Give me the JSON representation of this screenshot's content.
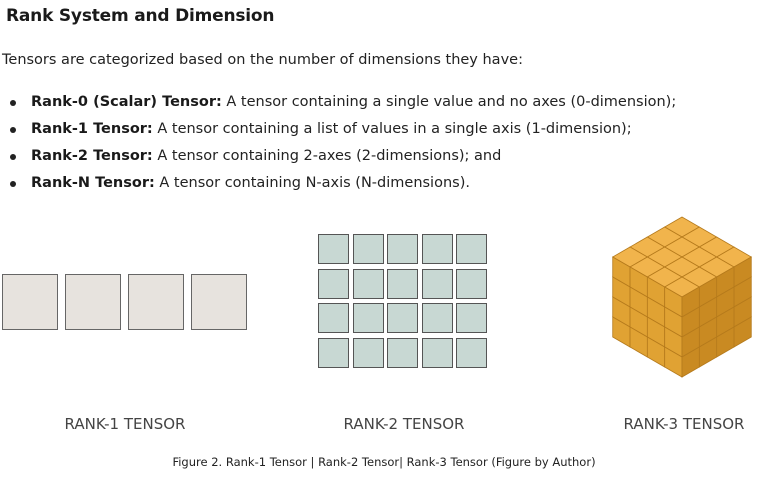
{
  "heading": "Rank System and Dimension",
  "intro": "Tensors are categorized based on the number of dimensions they have:",
  "bullets": [
    {
      "term": "Rank-0 (Scalar) Tensor:",
      "text": " A tensor containing a single value and no axes (0-dimension);"
    },
    {
      "term": "Rank-1 Tensor:",
      "text": " A tensor containing a list of values in a single axis (1-dimension);"
    },
    {
      "term": "Rank-2 Tensor:",
      "text": " A tensor containing 2-axes (2-dimensions); and"
    },
    {
      "term": "Rank-N Tensor:",
      "text": " A tensor containing N-axis (N-dimensions)."
    }
  ],
  "figures": {
    "rank1_label": "RANK-1 TENSOR",
    "rank2_label": "RANK-2 TENSOR",
    "rank3_label": "RANK-3 TENSOR",
    "rank1_color": "#e7e3de",
    "rank2_color": "#c8d8d3",
    "rank3_color": "#e8a93c"
  },
  "caption": "Figure 2. Rank-1 Tensor | Rank-2 Tensor| Rank-3 Tensor (Figure by Author)"
}
